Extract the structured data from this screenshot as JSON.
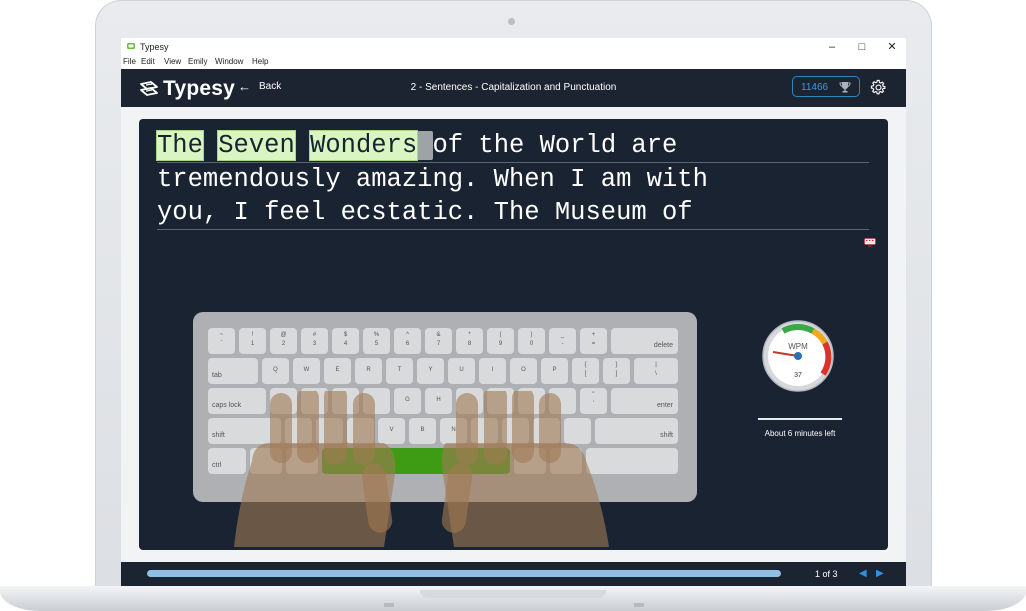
{
  "window": {
    "title": "Typesy",
    "controls": {
      "minimize": "–",
      "maximize": "□",
      "close": "✕"
    }
  },
  "menu": [
    "File",
    "Edit",
    "View",
    "Emily",
    "Window",
    "Help"
  ],
  "header": {
    "logo_text": "Typesy",
    "back_label": "Back",
    "lesson_title": "2 - Sentences - Capitalization and Punctuation",
    "score": "11466",
    "icons": {
      "back": "arrow-left-icon",
      "trophy": "trophy-icon",
      "settings": "gear-icon"
    }
  },
  "typing": {
    "line1": {
      "typed_words": [
        "The",
        "Seven",
        "Wonders"
      ],
      "rest": "of the World are"
    },
    "line2": "tremendously amazing. When I am with",
    "line3": "you, I feel ecstatic. The Museum of"
  },
  "keyboard": {
    "row1_top": [
      "~",
      "!",
      "@",
      "#",
      "$",
      "%",
      "^",
      "&",
      "*",
      "(",
      ")",
      "_",
      "+"
    ],
    "row1_bottom": [
      "`",
      "1",
      "2",
      "3",
      "4",
      "5",
      "6",
      "7",
      "8",
      "9",
      "0",
      "-",
      "="
    ],
    "row2": [
      "Q",
      "W",
      "E",
      "R",
      "T",
      "Y",
      "U",
      "I",
      "O",
      "P"
    ],
    "row2_brackets_top": [
      "{",
      "}",
      "|"
    ],
    "row2_brackets_bottom": [
      "[",
      "]",
      "\\"
    ],
    "row3_visible": [
      "G",
      "H"
    ],
    "row3_quote": [
      "\"",
      "'"
    ],
    "row4_visible": [
      "V",
      "B",
      "N"
    ],
    "labels": {
      "delete": "delete",
      "tab": "tab",
      "caps_lock": "caps lock",
      "enter": "enter",
      "shift": "shift",
      "ctrl": "ctrl"
    },
    "highlighted_key_color": "#3e9c14"
  },
  "stats": {
    "gauge_label": "WPM",
    "wpm": "37",
    "time_left": "About 6 minutes left"
  },
  "footer": {
    "page": "1 of 3",
    "prev": "◀",
    "next": "▶"
  },
  "colors": {
    "app_dark": "#1b2430",
    "panel": "#1a2331",
    "accent_blue": "#2e90e0",
    "typed_bg": "#d8f5c2"
  }
}
